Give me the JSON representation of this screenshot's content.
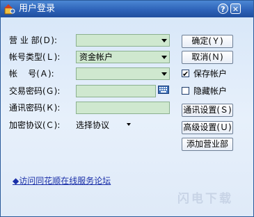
{
  "window": {
    "title": "用户登录"
  },
  "titlebar_buttons": {
    "help": "?",
    "close": "✕"
  },
  "form": {
    "branch": {
      "label": "营 业 部(Ｄ):",
      "value": ""
    },
    "account_type": {
      "label": "帐号类型(Ｌ):",
      "value": "资金帐户"
    },
    "account": {
      "label": "帐    号(Ａ):",
      "value": ""
    },
    "trade_password": {
      "label": "交易密码(Ｇ):",
      "value": ""
    },
    "comm_password": {
      "label": "通讯密码(Ｋ):",
      "value": ""
    },
    "encryption": {
      "label": "加密协议(Ｃ):",
      "value": "选择协议"
    }
  },
  "buttons": {
    "ok": "确定(Ｙ)",
    "cancel": "取消(Ｎ)",
    "comm_settings": "通讯设置(Ｓ)",
    "advanced": "高级设置(Ｕ)",
    "add_branch": "添加营业部"
  },
  "checkboxes": {
    "save_account": {
      "label": "保存帐户",
      "checked": true
    },
    "hide_account": {
      "label": "隐藏帐户",
      "checked": false
    }
  },
  "links": {
    "forum": "◆访问同花顺在线服务论坛"
  },
  "watermark": "闪电下载",
  "colors": {
    "titlebar": "#2e63b8",
    "field_bg": "#cfe8cf",
    "link": "#1a2fa8"
  }
}
